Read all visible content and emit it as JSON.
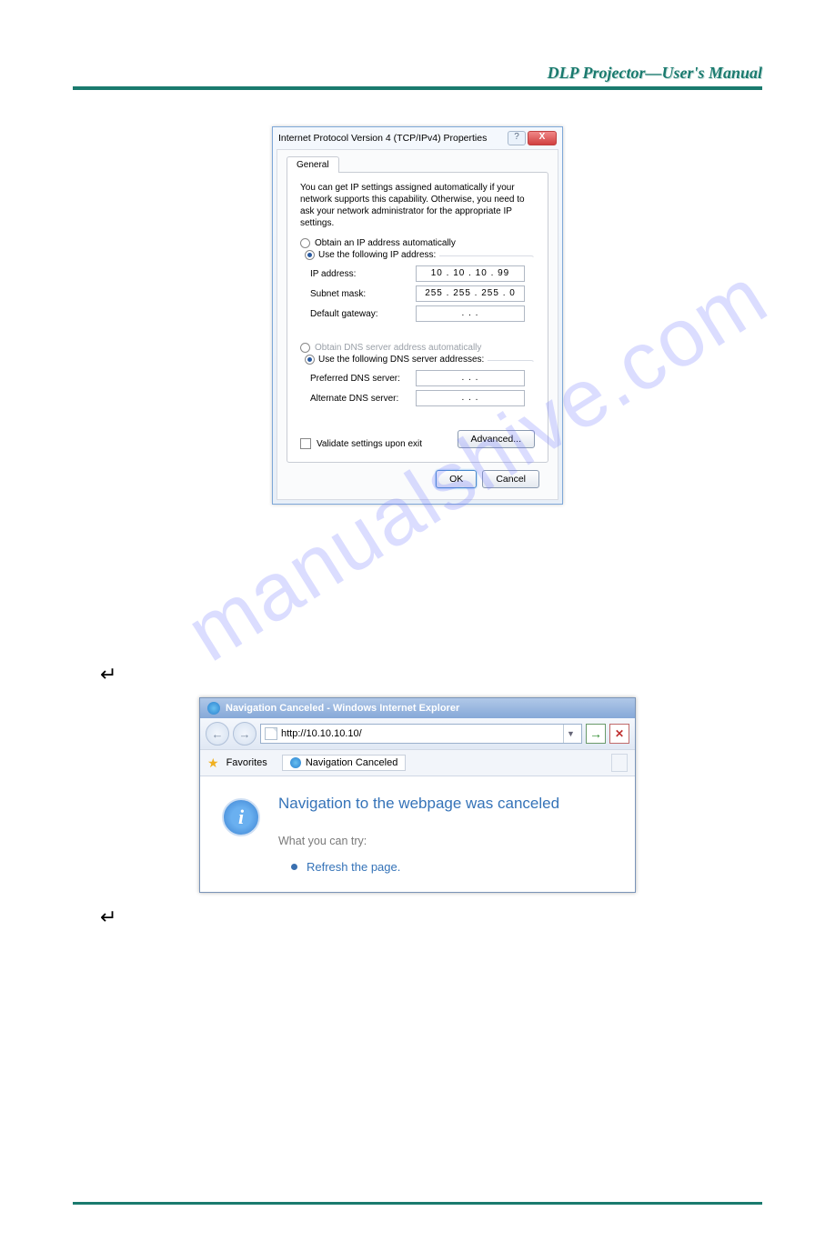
{
  "header": {
    "title": "DLP Projector—User's Manual"
  },
  "watermark": "manualshive.com",
  "dialog": {
    "title": "Internet Protocol Version 4 (TCP/IPv4) Properties",
    "help": "?",
    "close": "X",
    "tab": "General",
    "description": "You can get IP settings assigned automatically if your network supports this capability. Otherwise, you need to ask your network administrator for the appropriate IP settings.",
    "radio_auto_ip": "Obtain an IP address automatically",
    "radio_use_ip": "Use the following IP address:",
    "ip_label": "IP address:",
    "ip_value": "10  .  10  .  10  .  99",
    "subnet_label": "Subnet mask:",
    "subnet_value": "255 . 255 . 255 .  0",
    "gw_label": "Default gateway:",
    "gw_value": ".        .        .",
    "radio_auto_dns": "Obtain DNS server address automatically",
    "radio_use_dns": "Use the following DNS server addresses:",
    "pref_dns": "Preferred DNS server:",
    "alt_dns": "Alternate DNS server:",
    "dns_value": ".        .        .",
    "validate": "Validate settings upon exit",
    "advanced": "Advanced...",
    "ok": "OK",
    "cancel": "Cancel"
  },
  "return_arrow": "↵",
  "ie": {
    "title": "Navigation Canceled - Windows Internet Explorer",
    "back": "←",
    "fwd": "→",
    "url": "http://10.10.10.10/",
    "go": "→",
    "stop": "✕",
    "favorites": "Favorites",
    "tab": "Navigation Canceled",
    "heading": "Navigation to the webpage was canceled",
    "try": "What you can try:",
    "refresh": "Refresh the page."
  }
}
